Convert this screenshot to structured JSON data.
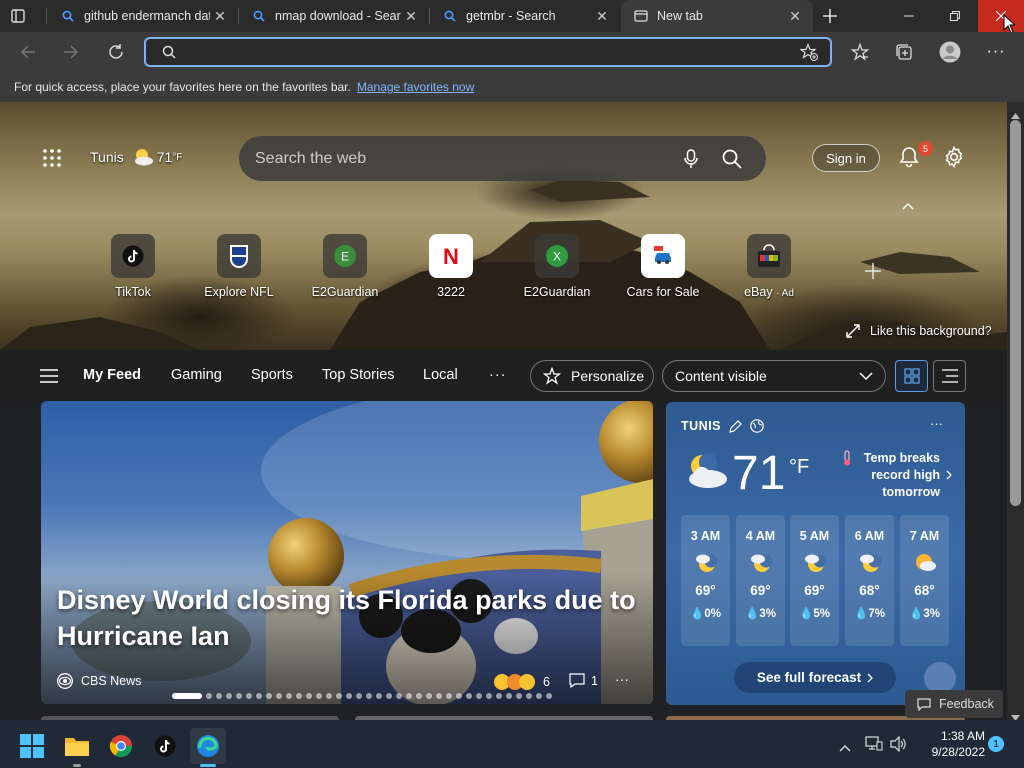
{
  "tabs": [
    {
      "label": "github endermanch dat",
      "icon": "search-icon"
    },
    {
      "label": "nmap download - Searc",
      "icon": "search-icon"
    },
    {
      "label": "getmbr - Search",
      "icon": "search-icon"
    },
    {
      "label": "New tab",
      "icon": "newtab-icon",
      "active": true
    }
  ],
  "omnibox": {
    "value": "",
    "placeholder": ""
  },
  "favorites_hint": {
    "text": "For quick access, place your favorites here on the favorites bar.",
    "link": "Manage favorites now"
  },
  "hero": {
    "location": "Tunis",
    "temp": "71",
    "unit": "°F",
    "search_placeholder": "Search the web",
    "sign_in": "Sign in",
    "notification_count": "5",
    "like_background": "Like this background?"
  },
  "shortcuts": [
    {
      "label": "TikTok",
      "icon": "tiktok-icon"
    },
    {
      "label": "Explore NFL",
      "icon": "nfl-icon"
    },
    {
      "label": "E2Guardian",
      "icon": "e-letter-icon",
      "letter": "E"
    },
    {
      "label": "3222",
      "icon": "netflix-icon",
      "letter": "N"
    },
    {
      "label": "E2Guardian",
      "icon": "x-letter-icon",
      "letter": "X"
    },
    {
      "label": "Cars for Sale",
      "icon": "car-icon"
    },
    {
      "label": "eBay",
      "ad": "· Ad",
      "icon": "ebay-icon"
    }
  ],
  "feed_nav": {
    "items": [
      "My Feed",
      "Gaming",
      "Sports",
      "Top Stories",
      "Local"
    ],
    "more": "···",
    "personalize": "Personalize",
    "content_visible": "Content visible"
  },
  "main_article": {
    "headline": "Disney World closing its Florida parks due to Hurricane Ian",
    "source": "CBS News",
    "reaction_count": "6",
    "comment_count": "1",
    "slides_total": 36,
    "slides_active": 1
  },
  "weather": {
    "city": "TUNIS",
    "temp": "71",
    "unit": "°F",
    "alert": "Temp breaks record high tomorrow",
    "hours": [
      {
        "time": "3 AM",
        "temp": "69°",
        "precip": "0%",
        "icon": "moon-cloud-icon"
      },
      {
        "time": "4 AM",
        "temp": "69°",
        "precip": "3%",
        "icon": "moon-cloud-icon"
      },
      {
        "time": "5 AM",
        "temp": "69°",
        "precip": "5%",
        "icon": "moon-cloud-icon"
      },
      {
        "time": "6 AM",
        "temp": "68°",
        "precip": "7%",
        "icon": "moon-cloud-icon"
      },
      {
        "time": "7 AM",
        "temp": "68°",
        "precip": "3%",
        "icon": "sun-cloud-icon"
      }
    ],
    "full_forecast": "See full forecast"
  },
  "feedback": "Feedback",
  "taskbar": {
    "time": "1:38 AM",
    "date": "9/28/2022",
    "notification_count": "1"
  },
  "colors": {
    "accent": "#7cb3f3",
    "notification_badge": "#e0492e",
    "close_button": "#c42b1c"
  }
}
